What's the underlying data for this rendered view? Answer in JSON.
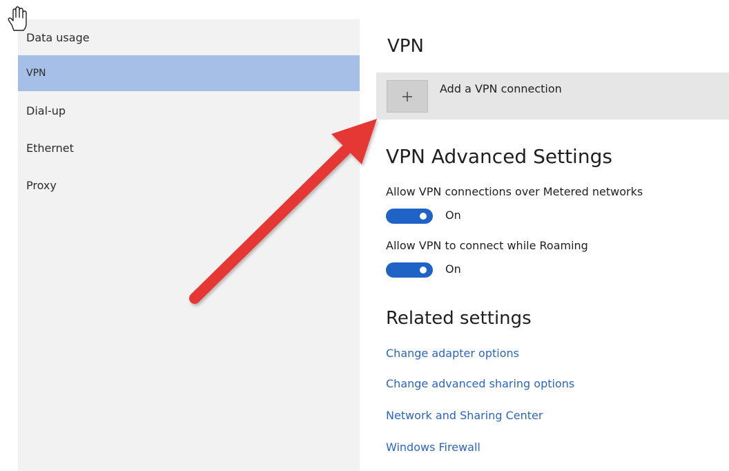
{
  "sidebar": {
    "items": [
      {
        "label": "Data usage",
        "active": false
      },
      {
        "label": "VPN",
        "active": true
      },
      {
        "label": "Dial-up",
        "active": false
      },
      {
        "label": "Ethernet",
        "active": false
      },
      {
        "label": "Proxy",
        "active": false
      }
    ]
  },
  "main": {
    "title": "VPN",
    "add_connection_label": "Add a VPN connection",
    "advanced": {
      "title": "VPN Advanced Settings",
      "options": [
        {
          "label": "Allow VPN connections over Metered networks",
          "state": "On"
        },
        {
          "label": "Allow VPN to connect while Roaming",
          "state": "On"
        }
      ]
    },
    "related": {
      "title": "Related settings",
      "links": [
        "Change adapter options",
        "Change advanced sharing options",
        "Network and Sharing Center",
        "Windows Firewall"
      ]
    }
  },
  "colors": {
    "sidebar_bg": "#f2f2f2",
    "active_item_bg": "#a5bfe6",
    "toggle_on": "#1f63c6",
    "link": "#2a66c0",
    "annotation_arrow": "#e53935"
  },
  "icons": {
    "cursor": "hand-cursor-icon",
    "add": "plus-icon",
    "annotation": "red-arrow-annotation"
  }
}
